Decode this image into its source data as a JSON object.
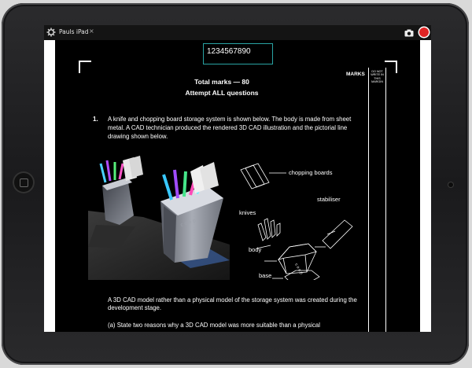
{
  "titlebar": {
    "device_name": "Pauls iPad",
    "close_glyph": "×",
    "icons": [
      "gear-icon",
      "camera-icon",
      "record-icon"
    ]
  },
  "candidate_number": "1234567890",
  "exam": {
    "total_marks": "Total marks — 80",
    "instruction": "Attempt ALL questions",
    "marks_header": "MARKS",
    "margin_note": [
      "DO NOT",
      "WRITE IN",
      "THIS",
      "MARGIN"
    ]
  },
  "question": {
    "number": "1.",
    "intro": "A knife and chopping board storage system is shown below. The body is made from sheet metal. A CAD technician produced the rendered 3D CAD illustration and the pictorial line drawing shown below.",
    "labels": {
      "chopping_boards": "chopping boards",
      "stabiliser": "stabiliser",
      "knives": "knives",
      "body": "body",
      "base": "base"
    },
    "paragraph": "A 3D CAD model rather than a physical model of the storage system was created during the development stage.",
    "part_a": "(a)   State two reasons why a 3D CAD model was more suitable than a physical"
  },
  "colors": {
    "record": "#e02424",
    "candidate_border": "#29a3a3",
    "page": "#000000"
  }
}
